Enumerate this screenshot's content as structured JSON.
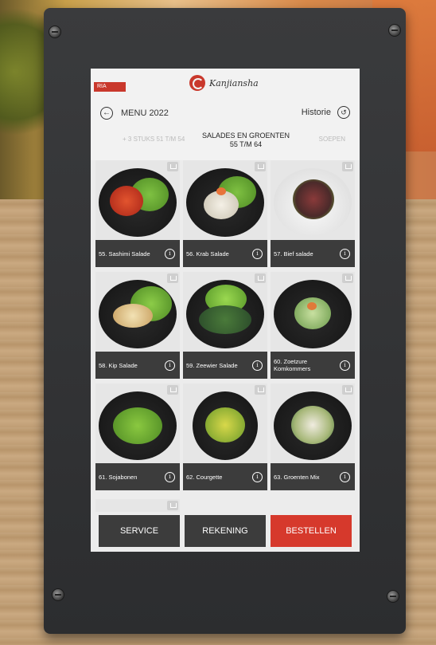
{
  "header": {
    "badge": "RIA",
    "brand": "Kanjiansha",
    "menu_title": "MENU 2022",
    "history_label": "Historie"
  },
  "categories": {
    "previous": "+ 3 STUKS 51 T/M 54",
    "active": "SALADES EN GROENTEN 55 T/M 64",
    "next": "SOEPEN"
  },
  "items": [
    {
      "label": "55. Sashimi Salade"
    },
    {
      "label": "56. Krab Salade"
    },
    {
      "label": "57. Bief salade"
    },
    {
      "label": "58. Kip Salade"
    },
    {
      "label": "59. Zeewier Salade"
    },
    {
      "label": "60. Zoetzure Komkommers"
    },
    {
      "label": "61. Sojabonen"
    },
    {
      "label": "62. Courgette"
    },
    {
      "label": "63. Groenten Mix"
    }
  ],
  "actions": {
    "service": "SERVICE",
    "rekening": "REKENING",
    "bestellen": "BESTELLEN"
  },
  "colors": {
    "accent": "#d6392c",
    "caption_bg": "#3c3c3c",
    "frame": "#2c2d2f"
  }
}
